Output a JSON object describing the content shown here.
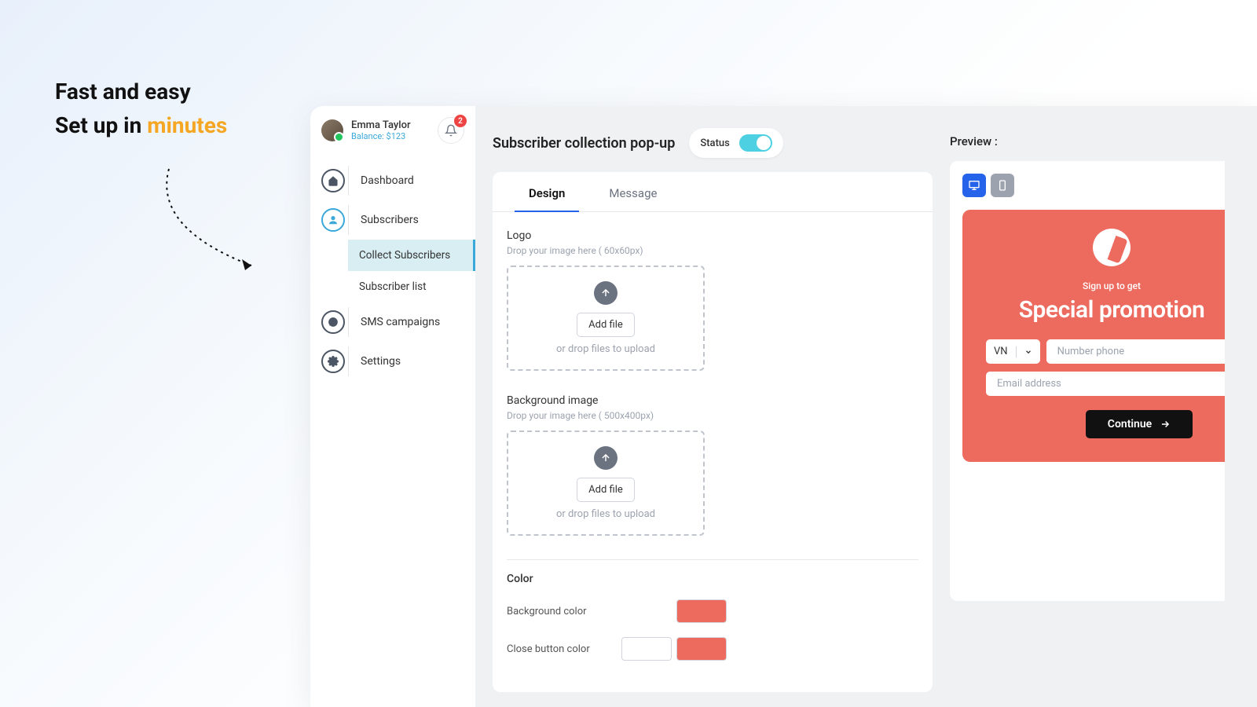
{
  "headline": {
    "line1": "Fast and easy",
    "line2_pre": "Set up in ",
    "line2_accent": "minutes"
  },
  "profile": {
    "name": "Emma Taylor",
    "balance": "Balance: $123",
    "notifications": "2"
  },
  "nav": {
    "dashboard": "Dashboard",
    "subscribers": "Subscribers",
    "collect": "Collect Subscribers",
    "list": "Subscriber list",
    "sms": "SMS campaigns",
    "settings": "Settings"
  },
  "page": {
    "title": "Subscriber collection pop-up",
    "status_label": "Status"
  },
  "tabs": {
    "design": "Design",
    "message": "Message"
  },
  "logo_field": {
    "label": "Logo",
    "hint": "Drop your image here ( 60x60px)",
    "add": "Add file",
    "drop": "or drop files to upload"
  },
  "bg_field": {
    "label": "Background image",
    "hint": "Drop your image here ( 500x400px)",
    "add": "Add file",
    "drop": "or drop files to upload"
  },
  "color_section": {
    "title": "Color",
    "bg": "Background color",
    "close": "Close button color"
  },
  "colors": {
    "accent": "#ec6a5e"
  },
  "preview": {
    "label": "Preview :"
  },
  "popup": {
    "sub": "Sign up to get",
    "title": "Special promotion",
    "country": "VN",
    "phone_placeholder": "Number phone",
    "email_placeholder": "Email address",
    "cta": "Continue"
  }
}
